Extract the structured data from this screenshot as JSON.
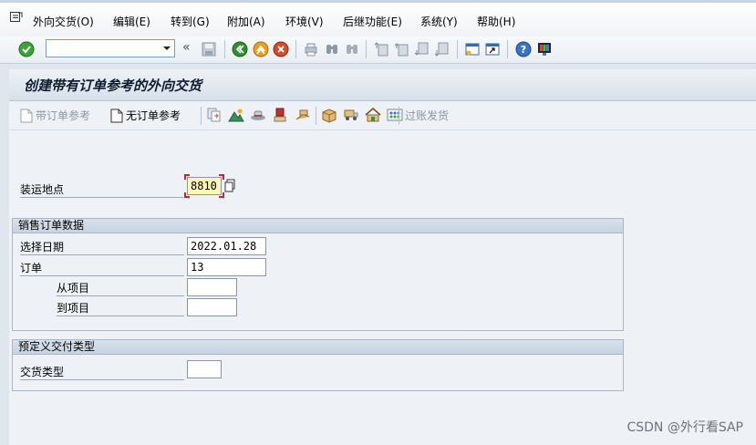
{
  "menubar": {
    "items": [
      "外向交货(O)",
      "编辑(E)",
      "转到(G)",
      "附加(A)",
      "环境(V)",
      "后继功能(E)",
      "系统(Y)",
      "帮助(H)"
    ]
  },
  "toolbar": {
    "command_value": "",
    "icons": [
      "enter-icon",
      "save-icon",
      "back-icon",
      "exit-icon",
      "cancel-icon",
      "print-icon",
      "find-icon",
      "find-next-icon",
      "first-page-icon",
      "prev-page-icon",
      "next-page-icon",
      "last-page-icon",
      "new-session-icon",
      "shortcut-icon",
      "help-icon",
      "customize-layout-icon"
    ]
  },
  "title": "创建带有订单参考的外向交货",
  "app_toolbar": {
    "with_order_ref": "带订单参考",
    "without_order_ref": "无订单参考",
    "post_goods_issue": "过账发货"
  },
  "form": {
    "shipping_point_label": "装运地点",
    "shipping_point_value": "8810",
    "sales_order_group": {
      "title": "销售订单数据",
      "selection_date_label": "选择日期",
      "selection_date_value": "2022.01.28",
      "order_label": "订单",
      "order_value": "13",
      "from_item_label": "从项目",
      "from_item_value": "",
      "to_item_label": "到项目",
      "to_item_value": ""
    },
    "delivery_type_group": {
      "title": "预定义交付类型",
      "delivery_type_label": "交货类型",
      "delivery_type_value": ""
    }
  },
  "watermark": "CSDN @外行看SAP",
  "colors": {
    "required_field_bg": "#fff5b4",
    "required_marker": "#cc2233",
    "enter_green": "#3aa43a",
    "back_green": "#2f8f2f",
    "exit_orange": "#e8a020",
    "cancel_red": "#d94a2a",
    "help_blue": "#3a72c4"
  }
}
